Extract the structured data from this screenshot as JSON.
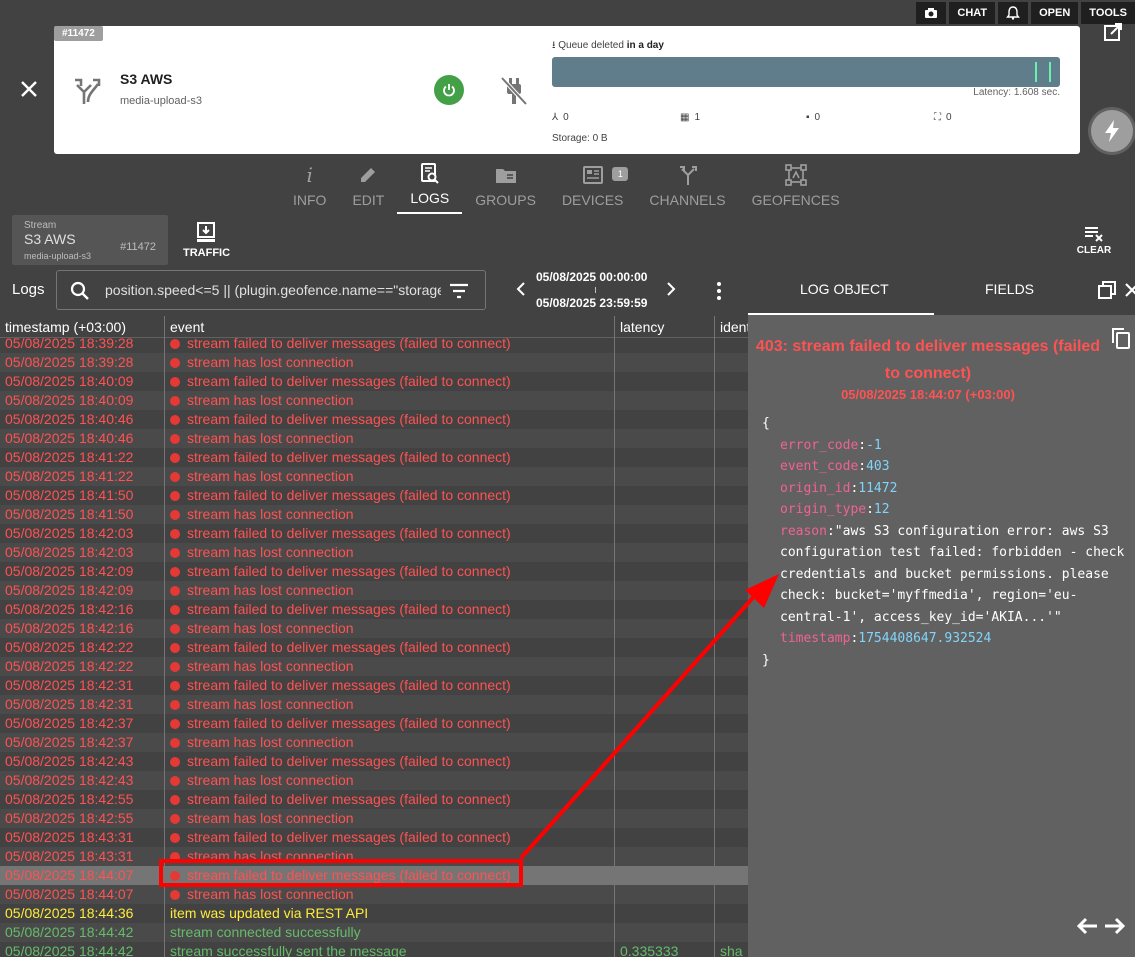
{
  "toolbar": {
    "camera_icon": "camera-icon",
    "chat": "CHAT",
    "bell_icon": "bell-icon",
    "open": "OPEN",
    "tools": "TOOLS"
  },
  "card": {
    "id_tag": "#11472",
    "title": "S3 AWS",
    "subtitle": "media-upload-s3",
    "queue_label_prefix": "Queue deleted",
    "queue_label_bold": "in a day",
    "latency": "Latency: 1.608 sec.",
    "stats": [
      "0",
      "1",
      "0",
      "0"
    ],
    "storage": "Storage: 0 B"
  },
  "tabs": [
    {
      "label": "INFO"
    },
    {
      "label": "EDIT"
    },
    {
      "label": "LOGS"
    },
    {
      "label": "GROUPS"
    },
    {
      "label": "DEVICES",
      "badge": "1"
    },
    {
      "label": "CHANNELS"
    },
    {
      "label": "GEOFENCES"
    }
  ],
  "stream_chip": {
    "caption": "Stream",
    "name": "S3 AWS",
    "sub": "media-upload-s3",
    "id": "#11472"
  },
  "traffic": "TRAFFIC",
  "clear": "CLEAR",
  "logs_toolbar": {
    "label": "Logs",
    "search_value": "position.speed<=5 || (plugin.geofence.name==\"storage",
    "date_from": "05/08/2025 00:00:00",
    "date_to": "05/08/2025 23:59:59"
  },
  "table": {
    "headers": [
      "timestamp (+03:00)",
      "event",
      "latency",
      "ident"
    ],
    "rows": [
      {
        "ts": "05/08/2025 18:39:28",
        "ev": "stream failed to deliver messages (failed to connect)",
        "type": "red",
        "icon": true,
        "lat": "",
        "idn": ""
      },
      {
        "ts": "05/08/2025 18:39:28",
        "ev": "stream has lost connection",
        "type": "red",
        "icon": true,
        "lat": "",
        "idn": ""
      },
      {
        "ts": "05/08/2025 18:40:09",
        "ev": "stream failed to deliver messages (failed to connect)",
        "type": "red",
        "icon": true,
        "lat": "",
        "idn": ""
      },
      {
        "ts": "05/08/2025 18:40:09",
        "ev": "stream has lost connection",
        "type": "red",
        "icon": true,
        "lat": "",
        "idn": ""
      },
      {
        "ts": "05/08/2025 18:40:46",
        "ev": "stream failed to deliver messages (failed to connect)",
        "type": "red",
        "icon": true,
        "lat": "",
        "idn": ""
      },
      {
        "ts": "05/08/2025 18:40:46",
        "ev": "stream has lost connection",
        "type": "red",
        "icon": true,
        "lat": "",
        "idn": ""
      },
      {
        "ts": "05/08/2025 18:41:22",
        "ev": "stream failed to deliver messages (failed to connect)",
        "type": "red",
        "icon": true,
        "lat": "",
        "idn": ""
      },
      {
        "ts": "05/08/2025 18:41:22",
        "ev": "stream has lost connection",
        "type": "red",
        "icon": true,
        "lat": "",
        "idn": ""
      },
      {
        "ts": "05/08/2025 18:41:50",
        "ev": "stream failed to deliver messages (failed to connect)",
        "type": "red",
        "icon": true,
        "lat": "",
        "idn": ""
      },
      {
        "ts": "05/08/2025 18:41:50",
        "ev": "stream has lost connection",
        "type": "red",
        "icon": true,
        "lat": "",
        "idn": ""
      },
      {
        "ts": "05/08/2025 18:42:03",
        "ev": "stream failed to deliver messages (failed to connect)",
        "type": "red",
        "icon": true,
        "lat": "",
        "idn": ""
      },
      {
        "ts": "05/08/2025 18:42:03",
        "ev": "stream has lost connection",
        "type": "red",
        "icon": true,
        "lat": "",
        "idn": ""
      },
      {
        "ts": "05/08/2025 18:42:09",
        "ev": "stream failed to deliver messages (failed to connect)",
        "type": "red",
        "icon": true,
        "lat": "",
        "idn": ""
      },
      {
        "ts": "05/08/2025 18:42:09",
        "ev": "stream has lost connection",
        "type": "red",
        "icon": true,
        "lat": "",
        "idn": ""
      },
      {
        "ts": "05/08/2025 18:42:16",
        "ev": "stream failed to deliver messages (failed to connect)",
        "type": "red",
        "icon": true,
        "lat": "",
        "idn": ""
      },
      {
        "ts": "05/08/2025 18:42:16",
        "ev": "stream has lost connection",
        "type": "red",
        "icon": true,
        "lat": "",
        "idn": ""
      },
      {
        "ts": "05/08/2025 18:42:22",
        "ev": "stream failed to deliver messages (failed to connect)",
        "type": "red",
        "icon": true,
        "lat": "",
        "idn": ""
      },
      {
        "ts": "05/08/2025 18:42:22",
        "ev": "stream has lost connection",
        "type": "red",
        "icon": true,
        "lat": "",
        "idn": ""
      },
      {
        "ts": "05/08/2025 18:42:31",
        "ev": "stream failed to deliver messages (failed to connect)",
        "type": "red",
        "icon": true,
        "lat": "",
        "idn": ""
      },
      {
        "ts": "05/08/2025 18:42:31",
        "ev": "stream has lost connection",
        "type": "red",
        "icon": true,
        "lat": "",
        "idn": ""
      },
      {
        "ts": "05/08/2025 18:42:37",
        "ev": "stream failed to deliver messages (failed to connect)",
        "type": "red",
        "icon": true,
        "lat": "",
        "idn": ""
      },
      {
        "ts": "05/08/2025 18:42:37",
        "ev": "stream has lost connection",
        "type": "red",
        "icon": true,
        "lat": "",
        "idn": ""
      },
      {
        "ts": "05/08/2025 18:42:43",
        "ev": "stream failed to deliver messages (failed to connect)",
        "type": "red",
        "icon": true,
        "lat": "",
        "idn": ""
      },
      {
        "ts": "05/08/2025 18:42:43",
        "ev": "stream has lost connection",
        "type": "red",
        "icon": true,
        "lat": "",
        "idn": ""
      },
      {
        "ts": "05/08/2025 18:42:55",
        "ev": "stream failed to deliver messages (failed to connect)",
        "type": "red",
        "icon": true,
        "lat": "",
        "idn": ""
      },
      {
        "ts": "05/08/2025 18:42:55",
        "ev": "stream has lost connection",
        "type": "red",
        "icon": true,
        "lat": "",
        "idn": ""
      },
      {
        "ts": "05/08/2025 18:43:31",
        "ev": "stream failed to deliver messages (failed to connect)",
        "type": "red",
        "icon": true,
        "lat": "",
        "idn": ""
      },
      {
        "ts": "05/08/2025 18:43:31",
        "ev": "stream has lost connection",
        "type": "red",
        "icon": true,
        "lat": "",
        "idn": ""
      },
      {
        "ts": "05/08/2025 18:44:07",
        "ev": "stream failed to deliver messages (failed to connect)",
        "type": "red",
        "icon": true,
        "lat": "",
        "idn": "",
        "selected": true
      },
      {
        "ts": "05/08/2025 18:44:07",
        "ev": "stream has lost connection",
        "type": "red",
        "icon": true,
        "lat": "",
        "idn": ""
      },
      {
        "ts": "05/08/2025 18:44:36",
        "ev": "item was updated via REST API",
        "type": "yellow",
        "icon": false,
        "lat": "",
        "idn": ""
      },
      {
        "ts": "05/08/2025 18:44:42",
        "ev": "stream connected successfully",
        "type": "green",
        "icon": false,
        "lat": "",
        "idn": ""
      },
      {
        "ts": "05/08/2025 18:44:42",
        "ev": "stream successfully sent the message",
        "type": "green",
        "icon": false,
        "lat": "0.335333",
        "idn": "sha"
      }
    ]
  },
  "panel": {
    "tab_log": "LOG OBJECT",
    "tab_fields": "FIELDS",
    "title": "403: stream failed to deliver messages (failed to connect)",
    "date": "05/08/2025 18:44:07 (+03:00)",
    "json_open": "{",
    "json_close": "}",
    "fields": [
      {
        "key": "error_code",
        "value": "-1",
        "kind": "num"
      },
      {
        "key": "event_code",
        "value": "403",
        "kind": "num"
      },
      {
        "key": "origin_id",
        "value": "11472",
        "kind": "num"
      },
      {
        "key": "origin_type",
        "value": "12",
        "kind": "num"
      },
      {
        "key": "reason",
        "value": "\"aws S3 configuration error: aws S3 configuration test failed: forbidden - check credentials and bucket permissions. please check: bucket='myffmedia', region='eu-central-1', access_key_id='AKIA...'\"",
        "kind": "str"
      },
      {
        "key": "timestamp",
        "value": "1754408647.932524",
        "kind": "num"
      }
    ]
  },
  "colors": {
    "error": "#ff5252",
    "warning": "#ffeb3b",
    "success": "#66bb6a",
    "annotation": "#ff0000"
  }
}
